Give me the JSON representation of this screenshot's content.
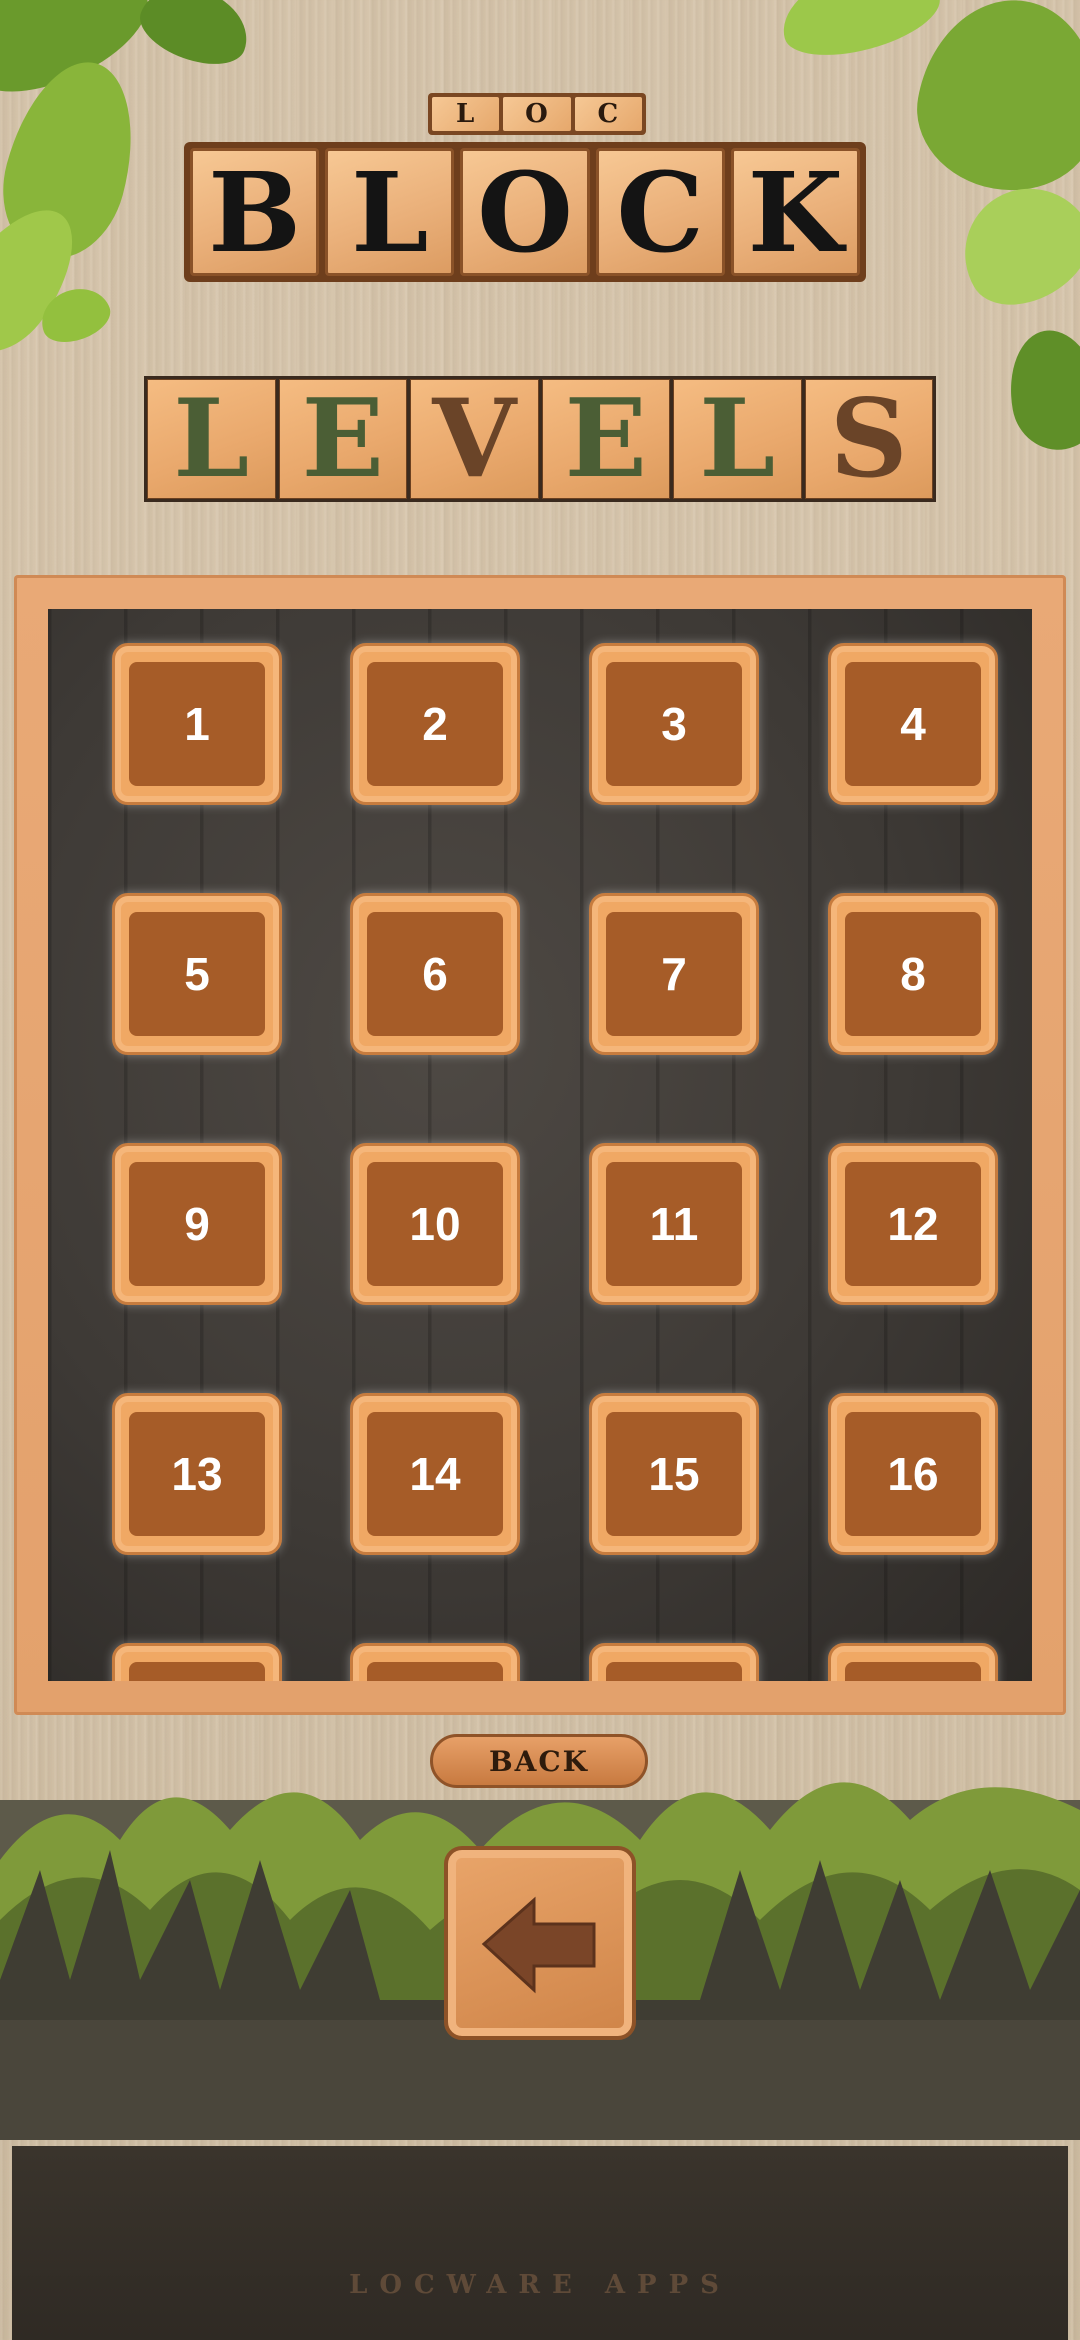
{
  "header": {
    "logo_small_letters": [
      "L",
      "O",
      "C"
    ],
    "logo_big_letters": [
      "B",
      "L",
      "O",
      "C",
      "K"
    ],
    "title_letters": [
      "L",
      "E",
      "V",
      "E",
      "L",
      "S"
    ]
  },
  "levels": [
    {
      "label": "1"
    },
    {
      "label": "2"
    },
    {
      "label": "3"
    },
    {
      "label": "4"
    },
    {
      "label": "5"
    },
    {
      "label": "6"
    },
    {
      "label": "7"
    },
    {
      "label": "8"
    },
    {
      "label": "9"
    },
    {
      "label": "10"
    },
    {
      "label": "11"
    },
    {
      "label": "12"
    },
    {
      "label": "13"
    },
    {
      "label": "14"
    },
    {
      "label": "15"
    },
    {
      "label": "16"
    }
  ],
  "navigation": {
    "back_label": "BACK",
    "back_icon": "left-arrow-icon"
  },
  "footer": {
    "brand": "LOCWARE APPS"
  },
  "colors": {
    "tile_face": "#a65c28",
    "tile_frame": "#f0a864",
    "board_bg": "#3e3a36",
    "title_green": "#4b5e35"
  }
}
